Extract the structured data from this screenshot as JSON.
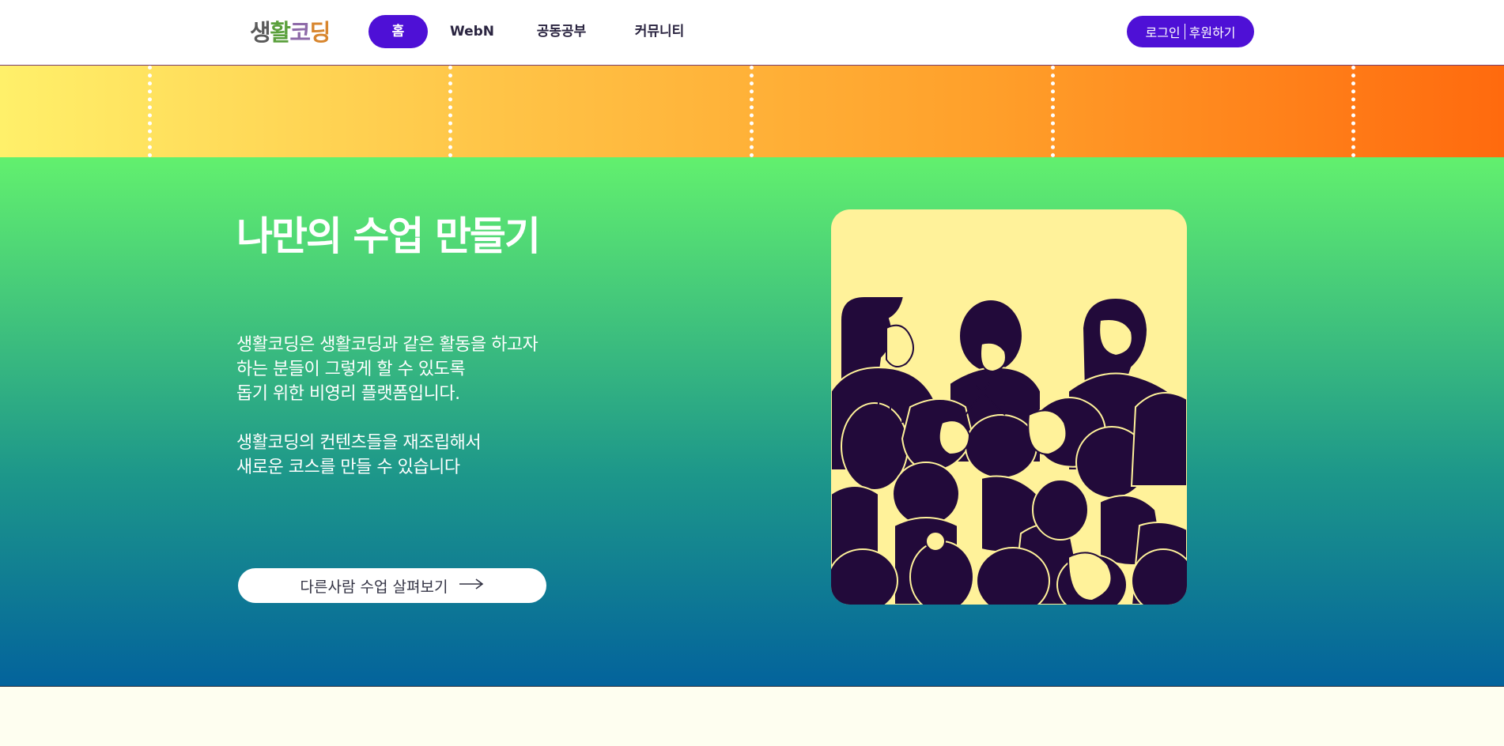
{
  "header": {
    "logo": [
      "생",
      "활",
      "코",
      "딩"
    ],
    "nav": [
      {
        "label": "홈",
        "active": true
      },
      {
        "label": "WebN",
        "active": false
      },
      {
        "label": "공동공부",
        "active": false
      },
      {
        "label": "커뮤니티",
        "active": false
      }
    ],
    "login_label": "로그인",
    "support_label": "후원하기"
  },
  "hero": {
    "title": "나만의 수업 만들기",
    "paragraph1": [
      "생활코딩은 생활코딩과 같은 활동을 하고자",
      "하는 분들이 그렇게 할 수 있도록",
      "돕기 위한 비영리 플랫폼입니다."
    ],
    "paragraph2": [
      "생활코딩의 컨텐츠들을 재조립해서",
      "새로운 코스를 만들 수 있습니다"
    ],
    "cta_label": "다른사람 수업 살펴보기",
    "illustration_icon": "crowd-illustration-icon"
  },
  "colors": {
    "brand": "#4e10d6",
    "hero_top": "#62f06e",
    "hero_bottom": "#03639c",
    "stripe_left": "#fff06a",
    "stripe_right": "#ff6a0e",
    "illustration_bg": "#fff29a",
    "illustration_ink": "#220a3a"
  }
}
